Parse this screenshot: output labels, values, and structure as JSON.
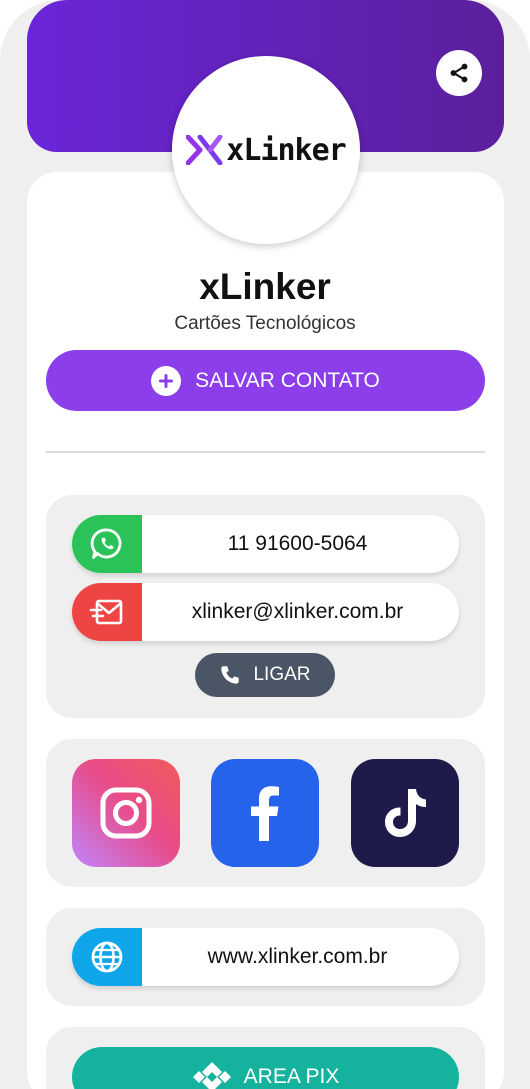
{
  "profile": {
    "logo_text": "xLinker",
    "name": "xLinker",
    "subtitle": "Cartões Tecnológicos"
  },
  "actions": {
    "save_label": "SALVAR CONTATO",
    "call_label": "LIGAR",
    "pix_label": "AREA PIX"
  },
  "contacts": {
    "whatsapp": "11 91600-5064",
    "email": "xlinker@xlinker.com.br",
    "website": "www.xlinker.com.br"
  },
  "social": [
    "instagram-icon",
    "facebook-icon",
    "tiktok-icon"
  ],
  "colors": {
    "header_gradient": [
      "#6b25d8",
      "#5b1f9c"
    ],
    "accent": "#8b3eea",
    "whatsapp": "#2bc25a",
    "email": "#ef4444",
    "website": "#0ea5e9",
    "call": "#4a5565",
    "pix": "#15b39d",
    "facebook": "#2563eb",
    "tiktok": "#1e1b4b"
  }
}
